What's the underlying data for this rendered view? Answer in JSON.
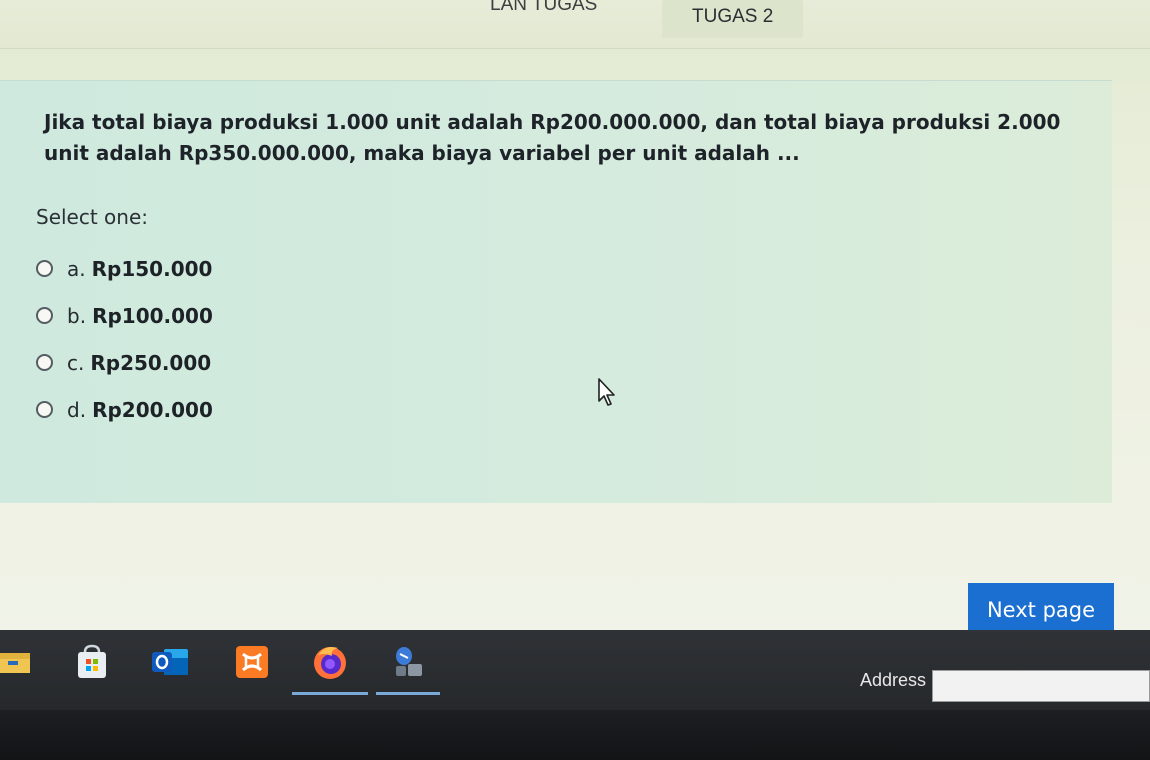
{
  "header": {
    "tab_left_label": "LAN TUGAS",
    "tab_active_label": "TUGAS 2"
  },
  "question": {
    "text": "Jika total biaya produksi 1.000 unit adalah Rp200.000.000, dan total biaya produksi 2.000 unit adalah Rp350.000.000, maka biaya variabel per unit adalah ...",
    "prompt": "Select one:",
    "options": [
      {
        "letter": "a.",
        "value": "Rp150.000"
      },
      {
        "letter": "b.",
        "value": "Rp100.000"
      },
      {
        "letter": "c.",
        "value": "Rp250.000"
      },
      {
        "letter": "d.",
        "value": "Rp200.000"
      }
    ]
  },
  "navigation": {
    "next_label": "Next page"
  },
  "taskbar": {
    "apps": [
      "file-explorer-icon",
      "microsoft-store-icon",
      "outlook-icon",
      "xampp-icon",
      "firefox-icon",
      "pinned-app-icon"
    ],
    "address_label": "Address",
    "address_value": ""
  },
  "colors": {
    "next_button": "#1a6fd0",
    "card_background": "#d4ebde",
    "taskbar": "#2b2e32"
  }
}
